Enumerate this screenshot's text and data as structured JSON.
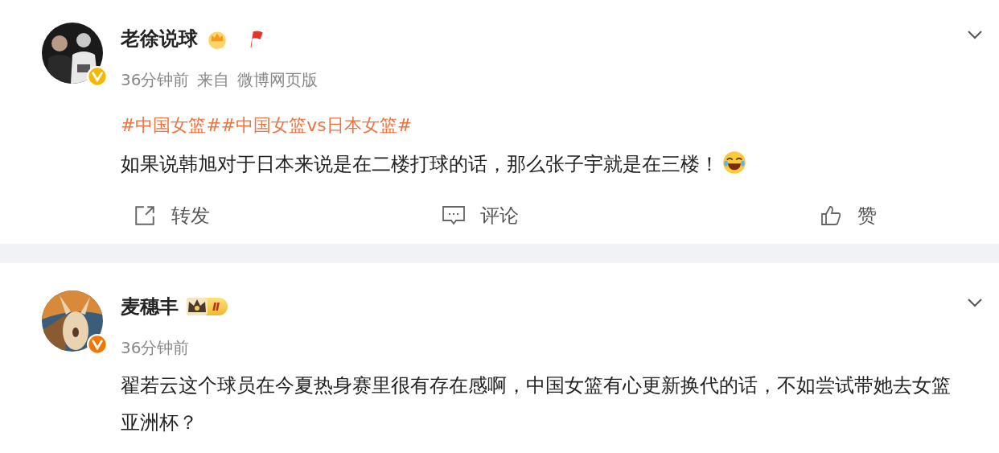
{
  "posts": [
    {
      "author": "老徐说球",
      "verified": {
        "color": "#f5b800"
      },
      "badges": [
        {
          "kind": "crown"
        },
        {
          "kind": "flag"
        }
      ],
      "time": "36分钟前",
      "source_prefix": "来自",
      "source": "微博网页版",
      "hashtags": "#中国女篮##中国女篮vs日本女篮#",
      "text": "如果说韩旭对于日本来说是在二楼打球的话，那么张子宇就是在三楼！",
      "emoji": true,
      "actions": [
        {
          "kind": "repost",
          "label": "转发"
        },
        {
          "kind": "comment",
          "label": "评论"
        },
        {
          "kind": "like",
          "label": "赞"
        }
      ]
    },
    {
      "author": "麦穗丰",
      "verified": {
        "color": "#f07800"
      },
      "badges": [
        {
          "kind": "level",
          "text": "Ⅱ"
        }
      ],
      "time": "36分钟前",
      "text": "翟若云这个球员在今夏热身赛里很有存在感啊，中国女篮有心更新换代的话，不如尝试带她去女篮亚洲杯？",
      "emoji": false
    }
  ]
}
